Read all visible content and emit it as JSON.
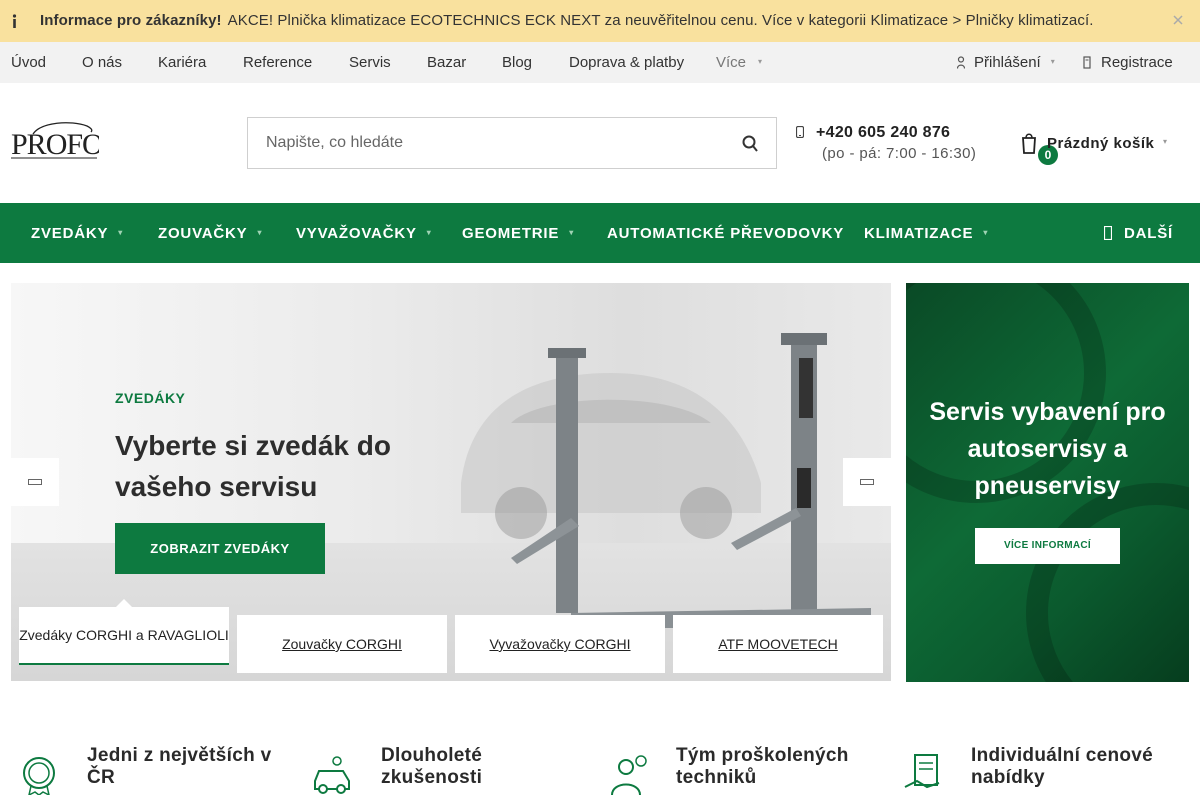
{
  "infobar": {
    "title": "Informace pro zákazníky!",
    "message": "AKCE! Plnička klimatizace ECOTECHNICS ECK NEXT za neuvěřitelnou cenu.  Více v kategorii Klimatizace > Plničky klimatizací.",
    "icon": "info-icon",
    "close_icon": "close-icon"
  },
  "topnav": {
    "items": [
      "Úvod",
      "O nás",
      "Kariéra",
      "Reference",
      "Servis",
      "Bazar",
      "Blog",
      "Doprava & platby"
    ],
    "more_label": "Více",
    "login_label": "Přihlášení",
    "register_label": "Registrace"
  },
  "header": {
    "logo_text": "PROFO",
    "search_placeholder": "Napište, co hledáte",
    "phone": "+420 605 240 876",
    "hours": "(po - pá: 7:00 - 16:30)",
    "cart_count": "0",
    "cart_label": "Prázdný košík"
  },
  "mainnav": {
    "items": [
      "ZVEDÁKY",
      "ZOUVAČKY",
      "VYVAŽOVAČKY",
      "GEOMETRIE",
      "AUTOMATICKÉ PŘEVODOVKY",
      "KLIMATIZACE"
    ],
    "more_label": "DALŠÍ"
  },
  "hero": {
    "kicker": "ZVEDÁKY",
    "headline": "Vyberte si zvedák do vašeho servisu",
    "cta": "ZOBRAZIT ZVEDÁKY",
    "tabs": [
      "Zvedáky CORGHI a RAVAGLIOLI",
      "Zouvačky CORGHI",
      "Vyvažovačky CORGHI",
      "ATF MOOVETECH"
    ],
    "active_tab": 0
  },
  "banner": {
    "text": "Servis vybavení pro autoservisy a pneuservisy",
    "button": "VÍCE INFORMACÍ"
  },
  "usp": [
    {
      "title": "Jedni z největších v ČR",
      "icon": "award-icon"
    },
    {
      "title": "Dlouholeté zkušenosti",
      "icon": "car-service-icon"
    },
    {
      "title": "Tým proškolených techniků",
      "icon": "technician-icon"
    },
    {
      "title": "Individuální cenové nabídky",
      "icon": "price-offer-icon"
    }
  ],
  "colors": {
    "brand_green": "#0d7a40",
    "info_bar": "#f9e19e",
    "topnav_bg": "#f2f2f2"
  }
}
